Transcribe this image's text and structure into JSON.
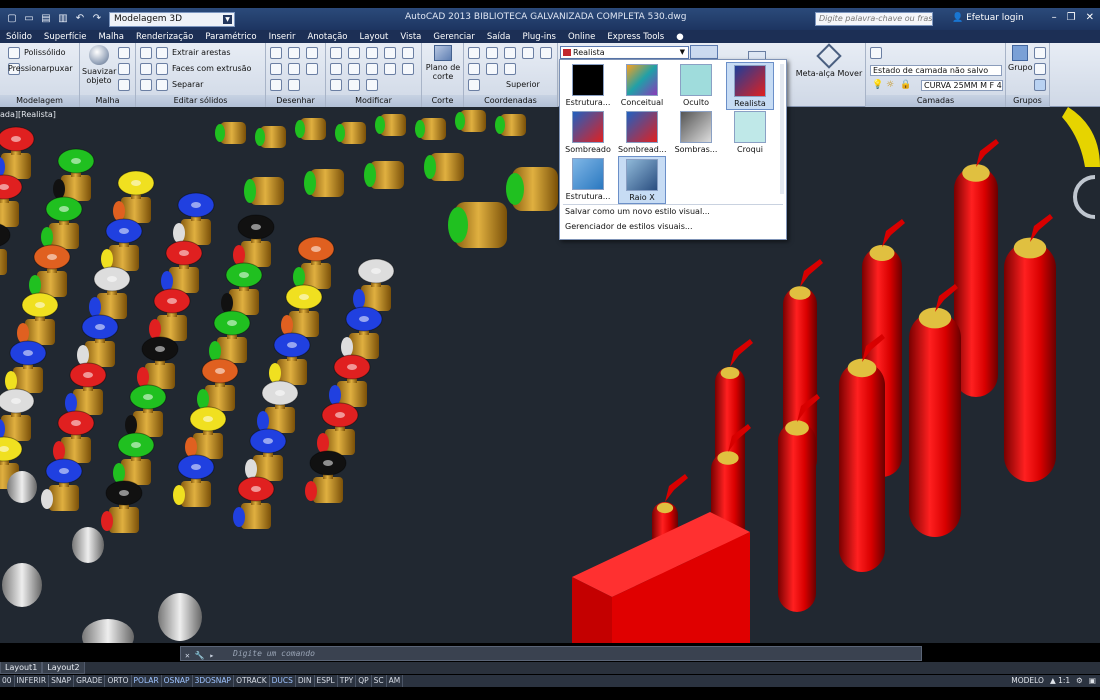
{
  "app": {
    "workspace": "Modelagem 3D",
    "title": "AutoCAD 2013   BIBLIOTECA GALVANIZADA COMPLETA 530.dwg",
    "search_placeholder": "Digite palavra-chave ou frase",
    "login": "Efetuar login"
  },
  "menu": [
    "Sólido",
    "Superfície",
    "Malha",
    "Renderização",
    "Paramétrico",
    "Inserir",
    "Anotação",
    "Layout",
    "Vista",
    "Gerenciar",
    "Saída",
    "Plug-ins",
    "Online",
    "Express Tools"
  ],
  "ribbon": {
    "panels": [
      "Modelagem",
      "Malha",
      "Editar sólidos",
      "Desenhar",
      "Modificar",
      "Corte",
      "Coordenadas",
      "Camadas",
      "Grupos"
    ],
    "items": {
      "polisolido": "Polissólido",
      "pressionar": "Pressionarpuxar",
      "suavizar": "Suavizar objeto",
      "extrair": "Extrair arestas",
      "faces": "Faces com extrusão",
      "separar": "Separar",
      "plano": "Plano de corte",
      "superior": "Superior",
      "meta": "Meta-alça Mover",
      "estado": "Estado de camada não salvo",
      "curva": "CURVA 25MM M F 4",
      "grupo": "Grupo"
    },
    "visual_style_current": "Realista"
  },
  "viewport_label": "ada][Realista]",
  "visual_styles": [
    {
      "label": "Estrutura...",
      "icon": "wireframe-2d-icon"
    },
    {
      "label": "Conceitual",
      "icon": "conceptual-icon"
    },
    {
      "label": "Oculto",
      "icon": "hidden-icon"
    },
    {
      "label": "Realista",
      "icon": "realistic-icon",
      "selected": true
    },
    {
      "label": "Sombreado",
      "icon": "shaded-icon"
    },
    {
      "label": "Sombread...",
      "icon": "shaded-edges-icon"
    },
    {
      "label": "Sombras...",
      "icon": "shades-of-gray-icon"
    },
    {
      "label": "Croqui",
      "icon": "sketchy-icon"
    },
    {
      "label": "Estrutura...",
      "icon": "wireframe-icon"
    },
    {
      "label": "Raio X",
      "icon": "xray-icon",
      "selected": true
    }
  ],
  "dropdown_links": [
    "Salvar como um novo estilo visual...",
    "Gerenciador de estilos visuais..."
  ],
  "command": {
    "placeholder": "Digite um comando"
  },
  "layout_tabs": [
    "Layout1",
    "Layout2"
  ],
  "status": {
    "coords": "00",
    "buttons": [
      "INFERIR",
      "SNAP",
      "GRADE",
      "ORTO",
      "POLAR",
      "OSNAP",
      "3DOSNAP",
      "OTRACK",
      "DUCS",
      "DIN",
      "ESPL",
      "TPY",
      "QP",
      "SC",
      "AM"
    ],
    "active": [
      "POLAR",
      "OSNAP",
      "3DOSNAP",
      "DUCS"
    ],
    "model": "MODELO",
    "scale": "1:1"
  }
}
